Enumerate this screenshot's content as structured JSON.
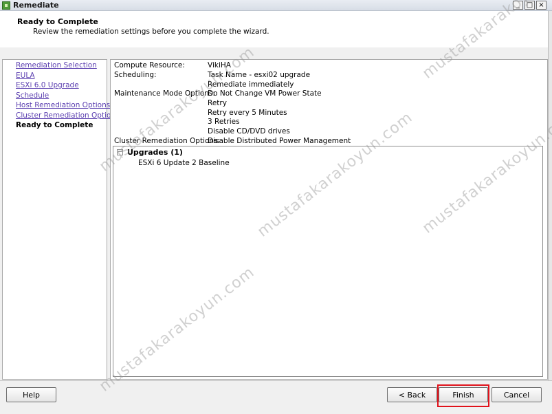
{
  "window": {
    "title": "Remediate"
  },
  "header": {
    "title": "Ready to Complete",
    "subtitle": "Review the remediation settings before you complete the wizard."
  },
  "nav": [
    {
      "label": "Remediation Selection",
      "current": false
    },
    {
      "label": "EULA",
      "current": false
    },
    {
      "label": "ESXi 6.0 Upgrade",
      "current": false
    },
    {
      "label": "Schedule",
      "current": false
    },
    {
      "label": "Host Remediation Options",
      "current": false
    },
    {
      "label": "Cluster Remediation Options",
      "current": false
    },
    {
      "label": "Ready to Complete",
      "current": true
    }
  ],
  "summary": {
    "compute_label": "Compute Resource:",
    "compute_value": "VikiHA",
    "scheduling_label": "Scheduling:",
    "scheduling_values": [
      "Task Name - esxi02 upgrade",
      "Remediate immediately"
    ],
    "maintenance_label": "Maintenance Mode Options:",
    "maintenance_values": [
      "Do Not Change VM Power State",
      "Retry",
      "Retry every 5 Minutes",
      "3 Retries",
      "Disable CD/DVD drives"
    ],
    "cluster_label": "Cluster Remediation Options:",
    "cluster_value": "Disable Distributed Power Management"
  },
  "upgrades": {
    "toggle": "−",
    "title": "Upgrades (1)",
    "items": [
      "ESXi 6 Update 2 Baseline"
    ]
  },
  "buttons": {
    "help": "Help",
    "back": "< Back",
    "finish": "Finish",
    "cancel": "Cancel"
  },
  "window_controls": {
    "minimize": "_",
    "maximize": "□",
    "close": "×"
  },
  "watermark": "mustafakarakoyun.com",
  "colors": {
    "link": "#5b3fb0",
    "highlight": "#e0121b"
  }
}
